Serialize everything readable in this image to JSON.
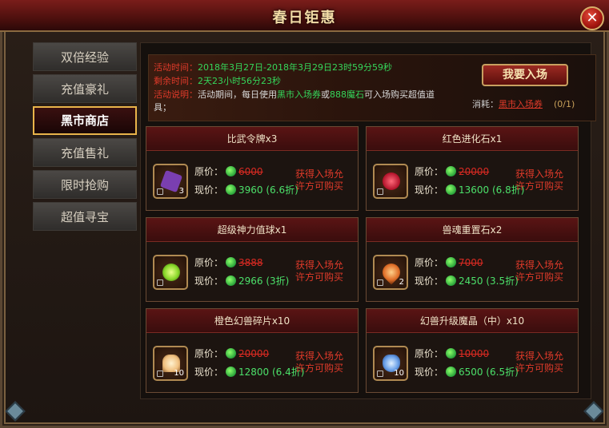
{
  "window": {
    "title": "春日钜惠",
    "close_label": "✕"
  },
  "sidebar": {
    "items": [
      {
        "label": "双倍经验",
        "active": false
      },
      {
        "label": "充值豪礼",
        "active": false
      },
      {
        "label": "黑市商店",
        "active": true
      },
      {
        "label": "充值售礼",
        "active": false
      },
      {
        "label": "限时抢购",
        "active": false
      },
      {
        "label": "超值寻宝",
        "active": false
      }
    ]
  },
  "info": {
    "time_label": "活动时间：",
    "time_value": "2018年3月27日-2018年3月29日23时59分59秒",
    "remain_label": "剩余时间：",
    "remain_value": "2天23小时56分23秒",
    "desc_label": "活动说明：",
    "desc_text_1": "活动期间，每日使用",
    "desc_highlight_1": "黑市入场券",
    "desc_text_2": "或",
    "desc_highlight_2": "888魔石",
    "desc_text_3": "可入场购买超值道",
    "desc_text_4": "具；",
    "enter_button": "我要入场",
    "consume_label": "消耗：",
    "consume_item": "黑市入场券",
    "consume_count": "(0/1)"
  },
  "price_labels": {
    "original": "原价：",
    "current": "现价："
  },
  "cards": [
    {
      "name": "比武令牌x3",
      "qty": "3",
      "original": "6000",
      "current": "3960 (6.6折)",
      "condition": "获得入场允许方可购买",
      "color": "#7a3fb0"
    },
    {
      "name": "红色进化石x1",
      "qty": "",
      "original": "20000",
      "current": "13600 (6.8折)",
      "condition": "获得入场允许方可购买",
      "color": "#d8303a"
    },
    {
      "name": "超级神力值球x1",
      "qty": "",
      "original": "3888",
      "current": "2966 (3折)",
      "condition": "获得入场允许方可购买",
      "color": "#9ad83a"
    },
    {
      "name": "兽魂重置石x2",
      "qty": "2",
      "original": "7000",
      "current": "2450 (3.5折)",
      "condition": "获得入场允许方可购买",
      "color": "#e0702a"
    },
    {
      "name": "橙色幻兽碎片x10",
      "qty": "10",
      "original": "20000",
      "current": "12800 (6.4折)",
      "condition": "获得入场允许方可购买",
      "color": "#f0c080"
    },
    {
      "name": "幻兽升级魔晶（中）x10",
      "qty": "10",
      "original": "10000",
      "current": "6500 (6.5折)",
      "condition": "获得入场允许方可购买",
      "color": "#6aa0e8"
    }
  ]
}
